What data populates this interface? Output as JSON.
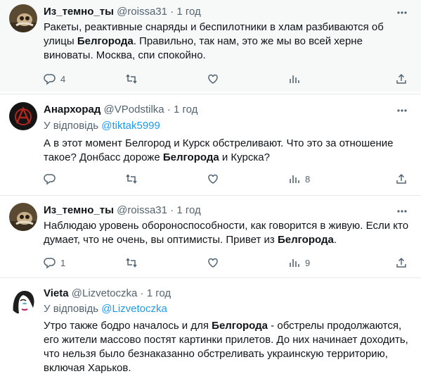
{
  "tweets": [
    {
      "name": "Из_темно_ты",
      "handle": "@roissa31",
      "time": "1 год",
      "reply_label": "",
      "reply_to": "",
      "text_parts": [
        {
          "t": "Ракеты, реактивные снаряды и беспилотники в хлам разбиваются об улицы ",
          "b": false
        },
        {
          "t": "Белгорода",
          "b": true
        },
        {
          "t": ". Правильно, так нам, это же мы во всей херне виноваты. Москва, спи спокойно.",
          "b": false
        }
      ],
      "replies": "4",
      "retweets": "",
      "likes": "",
      "views": "",
      "avatar_icon": "owl-avatar"
    },
    {
      "name": "Анархорад",
      "handle": "@VPodstilka",
      "time": "1 год",
      "reply_label": "У відповідь",
      "reply_to": "@tiktak5999",
      "text_parts": [
        {
          "t": "А в этот момент Белгород и Курск обстреливают. Что это за отношение такое? Донбасс дороже ",
          "b": false
        },
        {
          "t": "Белгорода",
          "b": true
        },
        {
          "t": " и Курска?",
          "b": false
        }
      ],
      "replies": "",
      "retweets": "",
      "likes": "",
      "views": "8",
      "avatar_icon": "anarchy-avatar"
    },
    {
      "name": "Из_темно_ты",
      "handle": "@roissa31",
      "time": "1 год",
      "reply_label": "",
      "reply_to": "",
      "text_parts": [
        {
          "t": "Наблюдаю уровень обороноспособности, как говорится в живую. Если кто думает, что не очень, вы оптимисты. Привет из ",
          "b": false
        },
        {
          "t": "Белгорода",
          "b": true
        },
        {
          "t": ".",
          "b": false
        }
      ],
      "replies": "1",
      "retweets": "",
      "likes": "",
      "views": "9",
      "avatar_icon": "owl-avatar"
    },
    {
      "name": "Vieta",
      "handle": "@Lizvetoczka",
      "time": "1 год",
      "reply_label": "У відповідь",
      "reply_to": "@Lizvetoczka",
      "text_parts": [
        {
          "t": "Утро также бодро началось и для ",
          "b": false
        },
        {
          "t": "Белгорода",
          "b": true
        },
        {
          "t": " - обстрелы продолжаются, его жители массово постят картинки прилетов. До них начинает доходить, что нельзя было безнаказанно обстреливать украинскую территорию, включая Харьков.",
          "b": false
        }
      ],
      "replies": "",
      "retweets": "",
      "likes": "",
      "views": "",
      "avatar_icon": "face-avatar"
    }
  ],
  "icons": {
    "reply": "reply-icon",
    "retweet": "retweet-icon",
    "like": "like-icon",
    "views": "views-icon",
    "share": "share-icon",
    "more": "more-icon"
  },
  "colors": {
    "text": "#0f1419",
    "secondary": "#536471",
    "link": "#1d9bf0",
    "divider": "#e6e9ec",
    "unread_bg": "#f7f9f9"
  }
}
